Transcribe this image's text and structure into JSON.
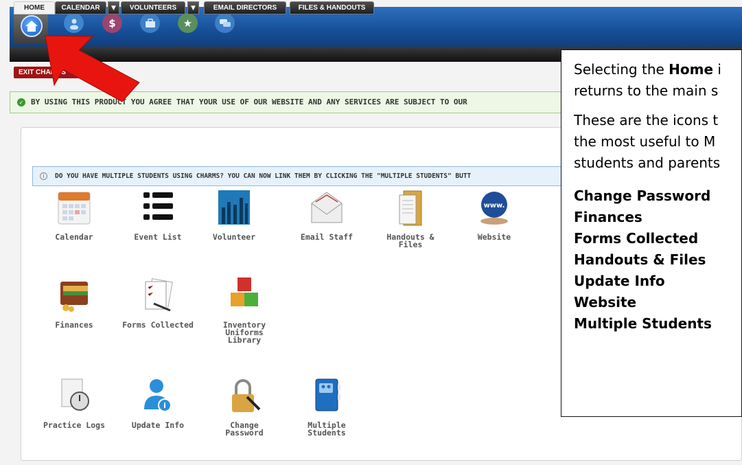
{
  "nav": {
    "tabs": [
      {
        "label": "HOME"
      },
      {
        "label": "CALENDAR"
      },
      {
        "label": "VOLUNTEERS"
      },
      {
        "label": "EMAIL DIRECTORS"
      },
      {
        "label": "FILES & HANDOUTS"
      }
    ],
    "top_icons": [
      "home-icon",
      "user-icon",
      "dollar-icon",
      "briefcase-icon",
      "star-icon",
      "chat-icon"
    ]
  },
  "exit_label": "EXIT CHARMS",
  "agreement_text": "BY USING THIS PRODUCT YOU AGREE THAT YOUR USE OF OUR WEBSITE AND ANY SERVICES ARE SUBJECT TO OUR",
  "notice_text": "DO YOU HAVE MULTIPLE STUDENTS USING CHARMS? YOU CAN NOW LINK THEM BY CLICKING THE \"MULTIPLE STUDENTS\" BUTT",
  "apps": {
    "calendar": "Calendar",
    "event_list": "Event List",
    "volunteer": "Volunteer",
    "email_staff": "Email Staff",
    "handouts": "Handouts & Files",
    "website": "Website",
    "finances": "Finances",
    "forms": "Forms Collected",
    "inventory": "Inventory\nUniforms\nLibrary",
    "practice": "Practice Logs",
    "update": "Update Info",
    "password": "Change\nPassword",
    "multiple": "Multiple\nStudents"
  },
  "callout": {
    "line1_pre": "Selecting the ",
    "line1_bold": "Home",
    "line1_post": " i",
    "line2": "returns to the main s",
    "line3": "These are the icons t",
    "line4": "the most useful to M",
    "line5": "students and parents",
    "items": [
      "Change Password",
      "Finances",
      "Forms Collected",
      "Handouts & Files",
      "Update Info",
      "Website",
      "Multiple Students"
    ]
  },
  "colors": {
    "top_bar": "#174f97",
    "exit": "#a11414",
    "arrow": "#e8150f",
    "agree_bg": "#eef7e6",
    "notice_bg": "#e6f1fb"
  }
}
